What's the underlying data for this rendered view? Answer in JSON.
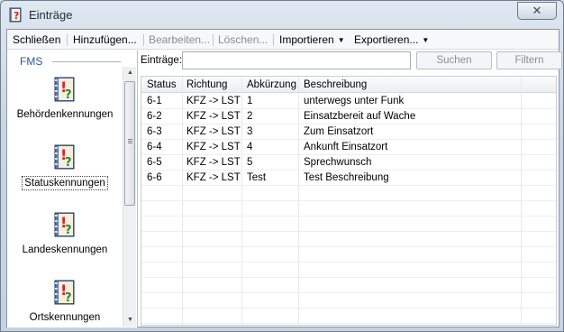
{
  "window": {
    "title": "Einträge",
    "close_glyph": "✕"
  },
  "menu": {
    "items": [
      {
        "label": "Schließen",
        "disabled": false
      },
      {
        "label": "Hinzufügen...",
        "disabled": false
      },
      {
        "label": "Bearbeiten...",
        "disabled": true
      },
      {
        "label": "Löschen...",
        "disabled": true
      },
      {
        "label": "Importieren",
        "disabled": false,
        "dropdown": true
      },
      {
        "label": "Exportieren...",
        "disabled": false,
        "dropdown": true
      }
    ],
    "dropdown_glyph": "▼"
  },
  "sidebar": {
    "header": "FMS",
    "items": [
      {
        "label": "Behördenkennungen",
        "icon": "book-question-icon",
        "selected": false
      },
      {
        "label": "Statuskennungen",
        "icon": "book-question-icon",
        "selected": true
      },
      {
        "label": "Landeskennungen",
        "icon": "book-question-icon",
        "selected": false
      },
      {
        "label": "Ortskennungen",
        "icon": "book-question-icon",
        "selected": false
      }
    ],
    "scroll_up_glyph": "▲",
    "scroll_down_glyph": "▼"
  },
  "filter": {
    "label": "Einträge:",
    "value": "",
    "search_button": "Suchen",
    "filter_button": "Filtern"
  },
  "table": {
    "columns": [
      "Status",
      "Richtung",
      "Abkürzung",
      "Beschreibung"
    ],
    "rows": [
      [
        "6-1",
        "KFZ -> LST",
        "1",
        "unterwegs unter Funk"
      ],
      [
        "6-2",
        "KFZ -> LST",
        "2",
        "Einsatzbereit auf Wache"
      ],
      [
        "6-3",
        "KFZ -> LST",
        "3",
        "Zum Einsatzort"
      ],
      [
        "6-4",
        "KFZ -> LST",
        "4",
        "Ankunft Einsatzort"
      ],
      [
        "6-5",
        "KFZ -> LST",
        "5",
        "Sprechwunsch"
      ],
      [
        "6-6",
        "KFZ -> LST",
        "Test",
        "Test Beschreibung"
      ]
    ]
  },
  "colors": {
    "accent": "#2a55a8",
    "disabled_text": "#8b8b8b"
  }
}
